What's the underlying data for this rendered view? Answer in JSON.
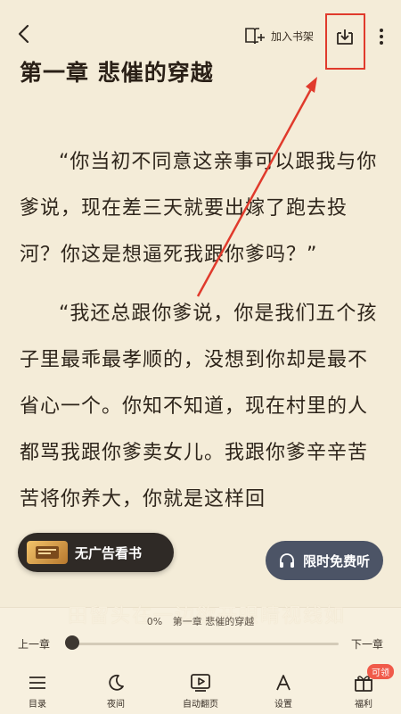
{
  "header": {
    "add_shelf_label": "加入书架"
  },
  "chapter": {
    "title": "第一章   悲催的穿越",
    "paragraphs": [
      "“你当初不同意这亲事可以跟我与你爹说，现在差三天就要出嫁了跑去投河？你这是想逼死我跟你爹吗？”",
      "“我还总跟你爹说，你是我们五个孩子里最乖最孝顺的，没想到你却是最不省心一个。你知不知道，现在村里的人都骂我跟你爹卖女儿。我跟你爹辛辛苦苦将你养大，你就是这样回"
    ],
    "faded_line": "田留头在一边欲开眼睛视线如"
  },
  "promos": {
    "ad_free_label": "无广告看书",
    "free_time_label": "限时免费听"
  },
  "progress": {
    "percent_label": "0%",
    "chapter_label": "第一章 悲催的穿越",
    "prev_label": "上一章",
    "next_label": "下一章",
    "value": 0
  },
  "tabs": [
    {
      "label": "目录",
      "icon": "list-icon"
    },
    {
      "label": "夜间",
      "icon": "moon-icon"
    },
    {
      "label": "自动翻页",
      "icon": "auto-page-icon"
    },
    {
      "label": "设置",
      "icon": "font-settings-icon"
    },
    {
      "label": "福利",
      "icon": "gift-icon",
      "badge": "可领"
    }
  ],
  "colors": {
    "page_bg": "#f4ecd8",
    "annotation_red": "#e03a2c",
    "badge_red": "#f05a4a"
  }
}
